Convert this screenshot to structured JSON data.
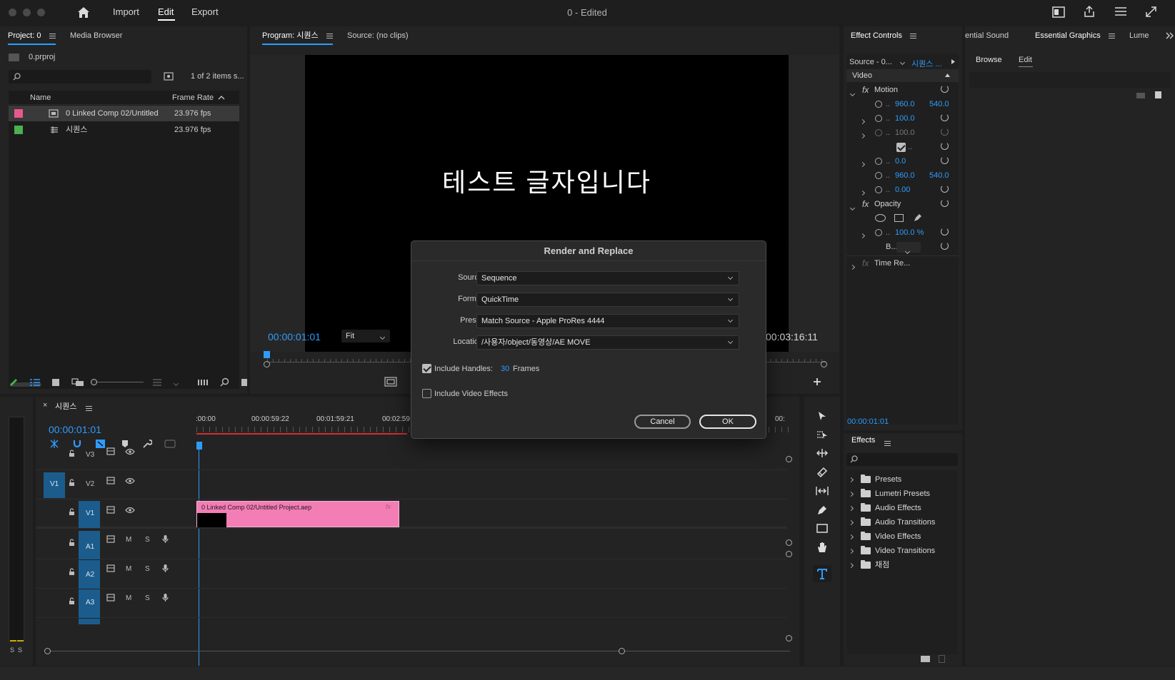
{
  "app": {
    "title": "0 - Edited",
    "menu": [
      "Import",
      "Edit",
      "Export"
    ],
    "active_menu": "Edit"
  },
  "project": {
    "tabs": [
      "Project: 0",
      "Media Browser"
    ],
    "filename": "0.prproj",
    "count": "1 of 2 items s...",
    "columns": [
      "Name",
      "Frame Rate"
    ],
    "items": [
      {
        "name": "0 Linked Comp 02/Untitled",
        "rate": "23.976 fps",
        "color": "#e8578f"
      },
      {
        "name": "시퀀스",
        "rate": "23.976 fps",
        "color": "#4caf50"
      }
    ]
  },
  "program": {
    "tabs": [
      "Program: 시퀀스",
      "Source: (no clips)"
    ],
    "overlay_text": "테스트 글자입니다",
    "timecode": "00:00:01:01",
    "fit": "Fit",
    "duration": "00:03:16:11"
  },
  "dialog": {
    "title": "Render and Replace",
    "source_label": "Source:",
    "source_value": "Sequence",
    "format_label": "Format:",
    "format_value": "QuickTime",
    "preset_label": "Preset:",
    "preset_value": "Match Source - Apple ProRes 4444",
    "location_label": "Location:",
    "location_value": "/사용자/object/동영상/AE MOVE",
    "handles_label": "Include Handles:",
    "handles_value": "30",
    "handles_unit": "Frames",
    "effects_label": "Include Video Effects",
    "cancel": "Cancel",
    "ok": "OK"
  },
  "effect_controls": {
    "title": "Effect Controls",
    "source": "Source - 0...",
    "sequence": "시퀀스 ...",
    "section": "Video",
    "motion": "Motion",
    "values": {
      "pos_x": "960.0",
      "pos_y": "540.0",
      "scale": "100.0",
      "scale_w": "100.0",
      "rotation": "0.0",
      "anchor_x": "960.0",
      "anchor_y": "540.0",
      "flicker": "0.00"
    },
    "opacity": "Opacity",
    "opacity_value": "100.0 %",
    "blend": "B...",
    "time_remap": "Time Re...",
    "timecode": "00:00:01:01"
  },
  "essential": {
    "tabs": [
      "ential Sound",
      "Essential Graphics",
      "Lume"
    ],
    "subtabs": [
      "Browse",
      "Edit"
    ]
  },
  "effects": {
    "title": "Effects",
    "items": [
      "Presets",
      "Lumetri Presets",
      "Audio Effects",
      "Audio Transitions",
      "Video Effects",
      "Video Transitions",
      "채점"
    ]
  },
  "timeline": {
    "tab": "시퀀스",
    "timecode": "00:00:01:01",
    "ruler": [
      ":00:00",
      "00:00:59:22",
      "00:01:59:21",
      "00:02:59",
      "00:"
    ],
    "video_tracks": [
      "V3",
      "V2",
      "V1"
    ],
    "audio_tracks": [
      "A1",
      "A2",
      "A3"
    ],
    "source_patch": "V1",
    "clip_label": "0 Linked Comp 02/Untitled Project.aep",
    "clip_fx": "fx",
    "meter_labels": [
      "S",
      "S"
    ],
    "audio_m": "M",
    "audio_s": "S"
  }
}
